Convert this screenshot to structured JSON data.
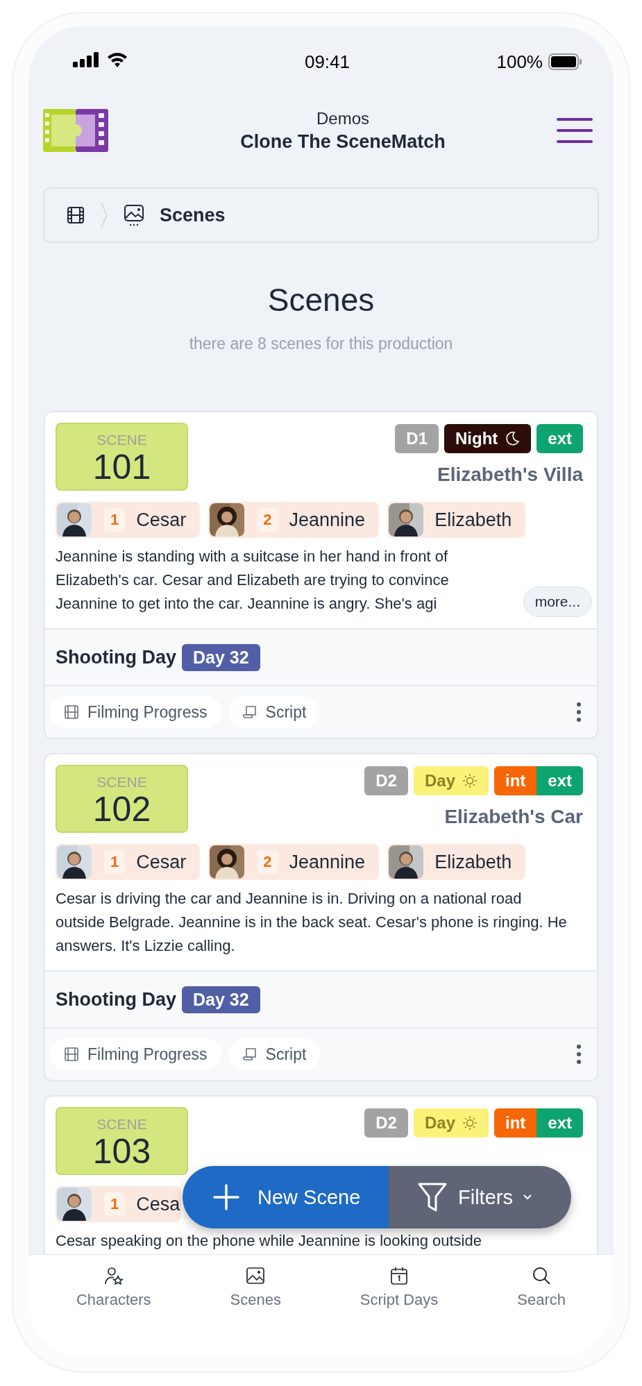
{
  "status_bar": {
    "time": "09:41",
    "battery": "100%"
  },
  "header": {
    "subtitle": "Demos",
    "title": "Clone The SceneMatch"
  },
  "breadcrumb": {
    "current": "Scenes"
  },
  "page": {
    "title": "Scenes",
    "subtitle": "there are 8 scenes for this production"
  },
  "scenes": [
    {
      "label": "SCENE",
      "number": "101",
      "script_day": "D1",
      "time": {
        "text": "Night",
        "kind": "night"
      },
      "setting": [
        {
          "text": "ext",
          "kind": "ext"
        }
      ],
      "location": "Elizabeth's Villa",
      "cast": [
        {
          "name": "Cesar",
          "number": "1"
        },
        {
          "name": "Jeannine",
          "number": "2"
        },
        {
          "name": "Elizabeth"
        }
      ],
      "description": "Jeannine is standing with a suitcase in her hand in front of Elizabeth's car. Cesar and Elizabeth are trying to convince Jeannine to get into the car. Jeannine is angry. She's agi",
      "more": "more...",
      "shooting_label": "Shooting Day",
      "shooting_day": "Day 32",
      "actions": [
        {
          "label": "Filming Progress",
          "kind": "progress"
        },
        {
          "label": "Script",
          "kind": "script"
        }
      ]
    },
    {
      "label": "SCENE",
      "number": "102",
      "script_day": "D2",
      "time": {
        "text": "Day",
        "kind": "day"
      },
      "setting": [
        {
          "text": "int",
          "kind": "int"
        },
        {
          "text": "ext",
          "kind": "ext"
        }
      ],
      "location": "Elizabeth's Car",
      "cast": [
        {
          "name": "Cesar",
          "number": "1"
        },
        {
          "name": "Jeannine",
          "number": "2"
        },
        {
          "name": "Elizabeth"
        }
      ],
      "description": "Cesar is driving the car and Jeannine is in. Driving on a national road outside Belgrade. Jeannine is in the back seat. Cesar's phone is ringing. He answers. It's Lizzie calling.",
      "shooting_label": "Shooting Day",
      "shooting_day": "Day 32",
      "actions": [
        {
          "label": "Filming Progress",
          "kind": "progress"
        },
        {
          "label": "Script",
          "kind": "script"
        }
      ]
    },
    {
      "label": "SCENE",
      "number": "103",
      "script_day": "D2",
      "time": {
        "text": "Day",
        "kind": "day"
      },
      "setting": [
        {
          "text": "int",
          "kind": "int"
        },
        {
          "text": "ext",
          "kind": "ext"
        }
      ],
      "cast": [
        {
          "name": "Cesa",
          "number": "1"
        }
      ],
      "description": "Cesar speaking on the phone while Jeannine is looking outside"
    }
  ],
  "fab": {
    "new_scene": "New Scene",
    "filters": "Filters"
  },
  "bottom_nav": [
    {
      "label": "Characters",
      "kind": "characters"
    },
    {
      "label": "Scenes",
      "kind": "scenes"
    },
    {
      "label": "Script Days",
      "kind": "days"
    },
    {
      "label": "Search",
      "kind": "search"
    }
  ]
}
